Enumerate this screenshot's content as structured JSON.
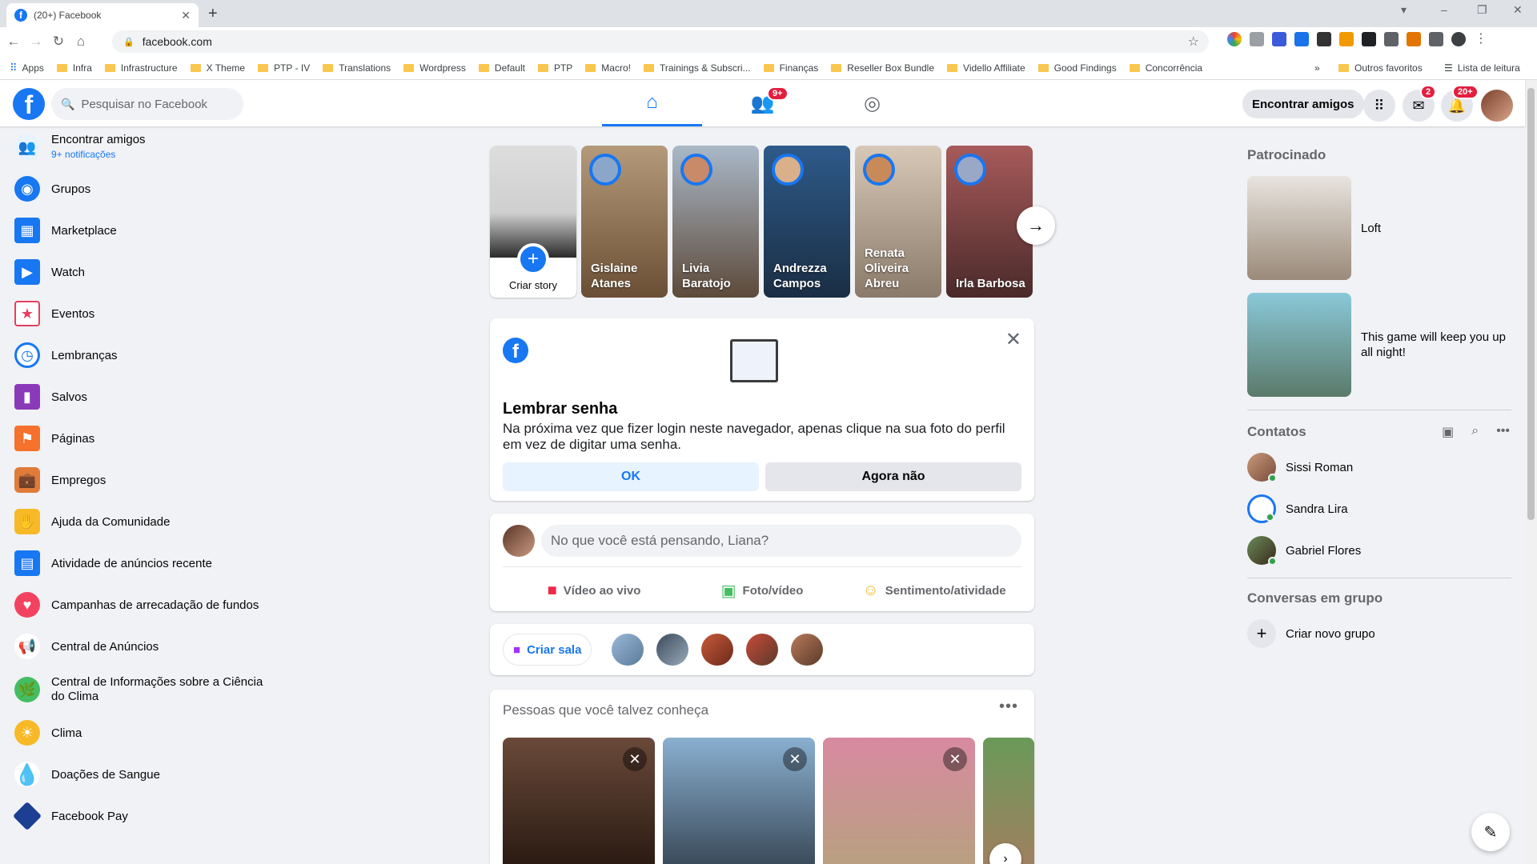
{
  "browser": {
    "tab_title": "(20+) Facebook",
    "url": "facebook.com",
    "bookmarks": [
      "Apps",
      "Infra",
      "Infrastructure",
      "X Theme",
      "PTP - IV",
      "Translations",
      "Wordpress",
      "Default",
      "PTP",
      "Macro!",
      "Trainings & Subscri...",
      "Finanças",
      "Reseller Box Bundle",
      "Vidello Affiliate",
      "Good Findings",
      "Concorrência"
    ],
    "bookmarks_more": "»",
    "other_bookmarks": "Outros favoritos",
    "reading_list": "Lista de leitura"
  },
  "topnav": {
    "search_placeholder": "Pesquisar no Facebook",
    "friends_badge": "9+",
    "find_friends": "Encontrar amigos",
    "messenger_badge": "2",
    "notifications_badge": "20+"
  },
  "sidebar": {
    "items": [
      {
        "label": "Encontrar amigos",
        "sub": "9+ notificações",
        "icon": "friends-icon",
        "color": "#1877f2"
      },
      {
        "label": "Grupos",
        "icon": "groups-icon",
        "color": "#1877f2"
      },
      {
        "label": "Marketplace",
        "icon": "marketplace-icon",
        "color": "#1877f2"
      },
      {
        "label": "Watch",
        "icon": "watch-icon",
        "color": "#1877f2"
      },
      {
        "label": "Eventos",
        "icon": "events-icon",
        "color": "#e4405f"
      },
      {
        "label": "Lembranças",
        "icon": "memories-icon",
        "color": "#1877f2"
      },
      {
        "label": "Salvos",
        "icon": "saved-icon",
        "color": "#8a3ab9"
      },
      {
        "label": "Páginas",
        "icon": "pages-icon",
        "color": "#f5712c"
      },
      {
        "label": "Empregos",
        "icon": "jobs-icon",
        "color": "#e07b39"
      },
      {
        "label": "Ajuda da Comunidade",
        "icon": "community-help-icon",
        "color": "#f7b928"
      },
      {
        "label": "Atividade de anúncios recente",
        "icon": "ad-activity-icon",
        "color": "#1877f2"
      },
      {
        "label": "Campanhas de arrecadação de fundos",
        "icon": "fundraisers-icon",
        "color": "#f3425f"
      },
      {
        "label": "Central de Anúncios",
        "icon": "ads-center-icon",
        "color": "#1877f2"
      },
      {
        "label": "Central de Informações sobre a Ciência do Clima",
        "icon": "climate-info-icon",
        "color": "#45bd62"
      },
      {
        "label": "Clima",
        "icon": "weather-icon",
        "color": "#f7b928"
      },
      {
        "label": "Doações de Sangue",
        "icon": "blood-donation-icon",
        "color": "#e41e3f"
      },
      {
        "label": "Facebook Pay",
        "icon": "facebook-pay-icon",
        "color": "#1c3f94"
      }
    ]
  },
  "stories": {
    "create_label": "Criar story",
    "items": [
      {
        "name": "Gislaine Atanes",
        "color": "#8a6a4a"
      },
      {
        "name": "Livia Baratojo",
        "color": "#7a8a9a"
      },
      {
        "name": "Andrezza Campos",
        "color": "#2e5a8a"
      },
      {
        "name": "Renata Oliveira Abreu",
        "color": "#c9a98a"
      },
      {
        "name": "Irla Barbosa",
        "color": "#8a3a3a"
      }
    ]
  },
  "remember": {
    "title": "Lembrar senha",
    "description": "Na próxima vez que fizer login neste navegador, apenas clique na sua foto do perfil em vez de digitar uma senha.",
    "ok": "OK",
    "not_now": "Agora não"
  },
  "composer": {
    "placeholder": "No que você está pensando, Liana?",
    "live_video": "Vídeo ao vivo",
    "photo_video": "Foto/vídeo",
    "feeling": "Sentimento/atividade"
  },
  "rooms": {
    "create_room": "Criar sala"
  },
  "people": {
    "title": "Pessoas que você talvez conheça"
  },
  "right": {
    "sponsored": "Patrocinado",
    "ads": [
      {
        "text": "Loft"
      },
      {
        "text": "This game will keep you up all night!"
      }
    ],
    "contacts_title": "Contatos",
    "contacts": [
      {
        "name": "Sissi Roman"
      },
      {
        "name": "Sandra Lira"
      },
      {
        "name": "Gabriel Flores"
      }
    ],
    "group_conversations": "Conversas em grupo",
    "new_group": "Criar novo grupo"
  }
}
